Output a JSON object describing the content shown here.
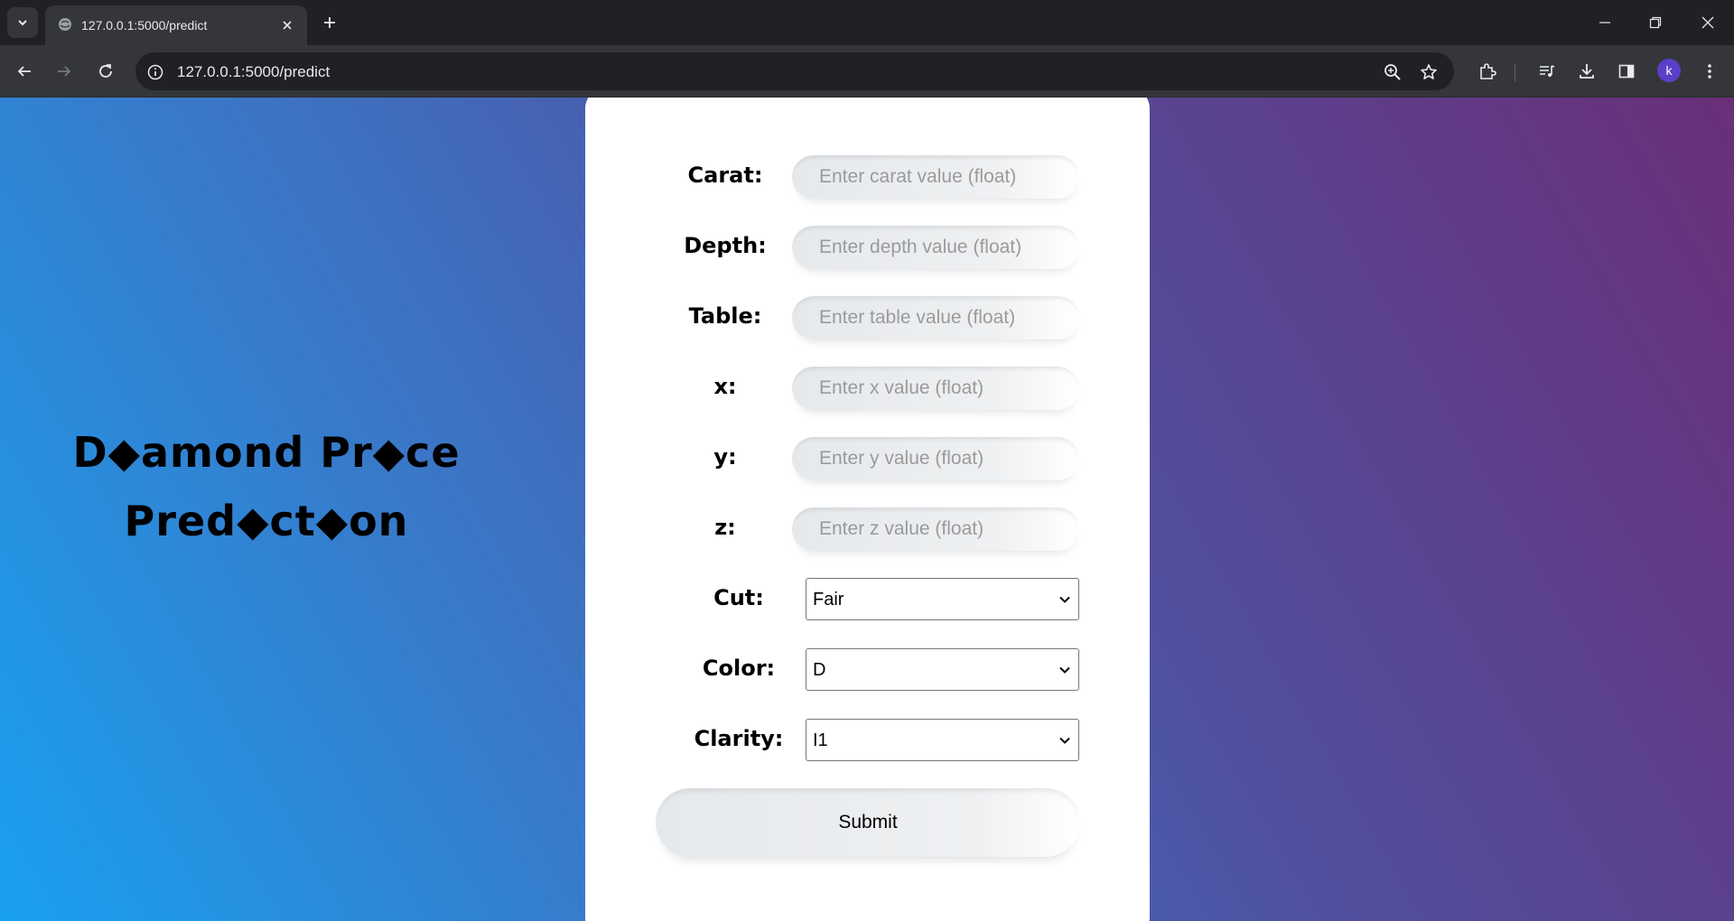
{
  "browser": {
    "tab_title": "127.0.0.1:5000/predict",
    "url": "127.0.0.1:5000/predict",
    "profile_initial": "k"
  },
  "page": {
    "title_line1": "D◆amond Pr◆ce",
    "title_line2": "Pred◆ct◆on",
    "fields": [
      {
        "label": "Carat:",
        "placeholder": "Enter carat value (float)"
      },
      {
        "label": "Depth:",
        "placeholder": "Enter depth value (float)"
      },
      {
        "label": "Table:",
        "placeholder": "Enter table value (float)"
      },
      {
        "label": "x:",
        "placeholder": "Enter x value (float)"
      },
      {
        "label": "y:",
        "placeholder": "Enter y value (float)"
      },
      {
        "label": "z:",
        "placeholder": "Enter z value (float)"
      }
    ],
    "selects": [
      {
        "label": "Cut:",
        "value": "Fair"
      },
      {
        "label": "Color:",
        "value": "D"
      },
      {
        "label": "Clarity:",
        "value": "I1"
      }
    ],
    "submit_label": "Submit"
  },
  "colors": {
    "gradient_start": "#1aa0f0",
    "gradient_end": "#6a2f78",
    "chrome_dark": "#202124",
    "chrome_toolbar": "#35363a",
    "avatar": "#5c3fc7"
  }
}
